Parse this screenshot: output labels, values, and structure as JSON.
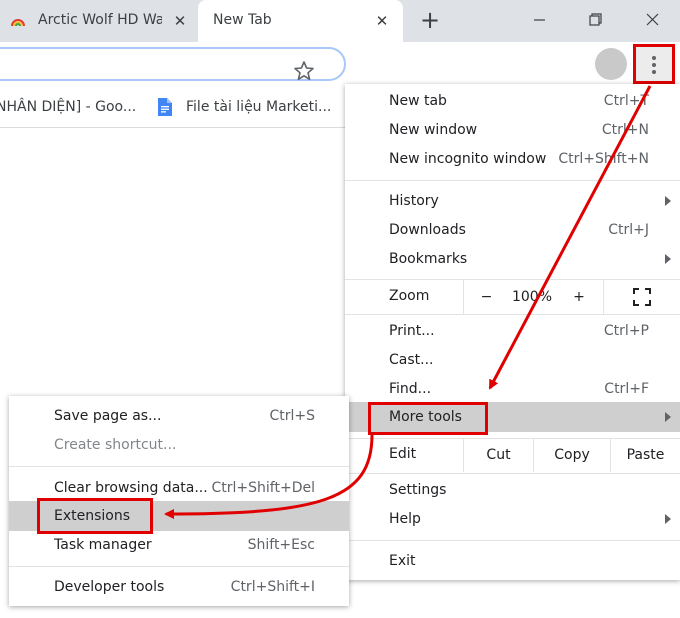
{
  "tabs": [
    {
      "title": "Arctic Wolf HD Wa",
      "close": "✕"
    },
    {
      "title": "New Tab",
      "close": "✕"
    }
  ],
  "window": {
    "new_tab": "+",
    "minimize": "—",
    "maximize": "❐",
    "close": "✕"
  },
  "bookmarks": [
    {
      "label": "NHÂN DIỆN] - Goo..."
    },
    {
      "label": "File tài liệu Marketi..."
    }
  ],
  "main_menu": {
    "new_tab": {
      "label": "New tab",
      "shortcut": "Ctrl+T"
    },
    "new_window": {
      "label": "New window",
      "shortcut": "Ctrl+N"
    },
    "new_incognito": {
      "label": "New incognito window",
      "shortcut": "Ctrl+Shift+N"
    },
    "history": {
      "label": "History"
    },
    "downloads": {
      "label": "Downloads",
      "shortcut": "Ctrl+J"
    },
    "bookmarks": {
      "label": "Bookmarks"
    },
    "zoom": {
      "label": "Zoom",
      "minus": "−",
      "value": "100%",
      "plus": "+"
    },
    "print": {
      "label": "Print...",
      "shortcut": "Ctrl+P"
    },
    "cast": {
      "label": "Cast..."
    },
    "find": {
      "label": "Find...",
      "shortcut": "Ctrl+F"
    },
    "more_tools": {
      "label": "More tools"
    },
    "edit": {
      "label": "Edit",
      "cut": "Cut",
      "copy": "Copy",
      "paste": "Paste"
    },
    "settings": {
      "label": "Settings"
    },
    "help": {
      "label": "Help"
    },
    "exit": {
      "label": "Exit"
    }
  },
  "sub_menu": {
    "save_page": {
      "label": "Save page as...",
      "shortcut": "Ctrl+S"
    },
    "create_shortcut": {
      "label": "Create shortcut..."
    },
    "clear_data": {
      "label": "Clear browsing data...",
      "shortcut": "Ctrl+Shift+Del"
    },
    "extensions": {
      "label": "Extensions"
    },
    "task_manager": {
      "label": "Task manager",
      "shortcut": "Shift+Esc"
    },
    "dev_tools": {
      "label": "Developer tools",
      "shortcut": "Ctrl+Shift+I"
    }
  },
  "colors": {
    "annotation": "#e00000",
    "highlight": "#cfcfcf",
    "tabstrip": "#dee1e6"
  }
}
